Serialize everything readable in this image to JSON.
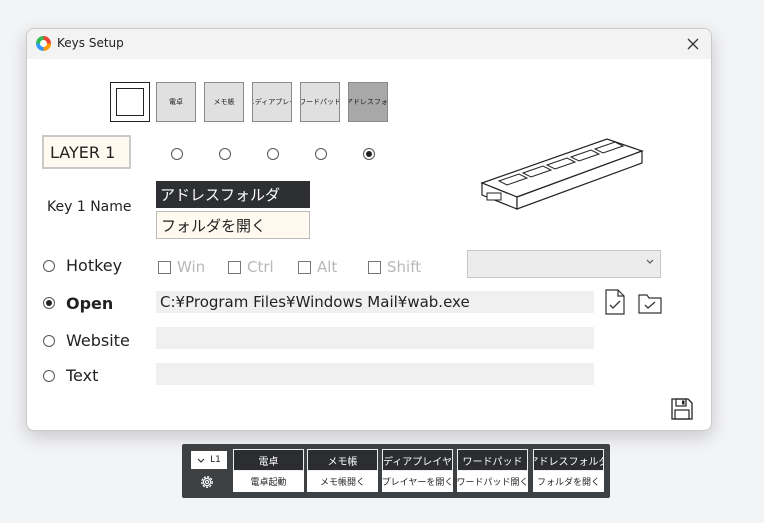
{
  "window": {
    "title": "Keys Setup"
  },
  "key_selector": {
    "keys": [
      {
        "label": ""
      },
      {
        "label": "電卓"
      },
      {
        "label": "メモ帳"
      },
      {
        "label": "メディアプレー"
      },
      {
        "label": "ワードパッド"
      },
      {
        "label": "アドレスフォ."
      }
    ],
    "selected_index": 5
  },
  "layer": {
    "label": "LAYER 1",
    "selected_index": 4
  },
  "key_name": {
    "label": "Key 1 Name",
    "display": "アドレスフォルダ",
    "value": "フォルダを開く"
  },
  "actions": {
    "selected": "Open",
    "hotkey": {
      "label": "Hotkey",
      "modifiers": [
        "Win",
        "Ctrl",
        "Alt",
        "Shift"
      ],
      "dropdown_value": ""
    },
    "open": {
      "label": "Open",
      "path": "C:¥Program Files¥Windows Mail¥wab.exe"
    },
    "website": {
      "label": "Website",
      "value": ""
    },
    "text": {
      "label": "Text",
      "value": ""
    }
  },
  "icons": {
    "file": "file-check-icon",
    "folder": "folder-check-icon",
    "save": "floppy-disk-icon",
    "gear": "gear-icon",
    "chevron": "chevron-down-icon"
  },
  "bottom_bar": {
    "layer_chip": "L1",
    "keys": [
      {
        "top": "電卓",
        "bottom": "電卓起動"
      },
      {
        "top": "メモ帳",
        "bottom": "メモ帳開く"
      },
      {
        "top": "メディアプレイヤー",
        "bottom": "プレイヤーを開く"
      },
      {
        "top": "ワードパッド",
        "bottom": "ワードパッド開く"
      },
      {
        "top": "アドレスフォルダ",
        "bottom": "フォルダを開く"
      }
    ]
  },
  "colors": {
    "accent_dark": "#2d2f33",
    "input_bg": "#fff9ef",
    "bar_bg": "#3d4144"
  }
}
